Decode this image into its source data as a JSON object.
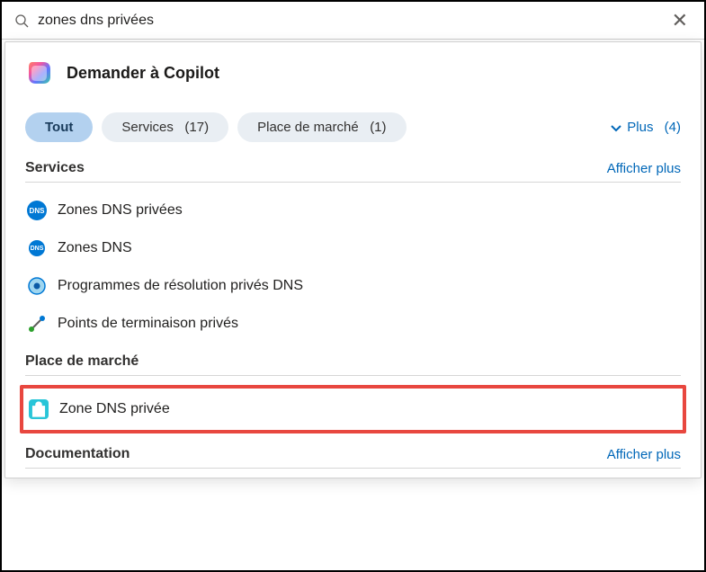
{
  "search": {
    "query": "zones dns privées",
    "placeholder": ""
  },
  "copilot": {
    "label": "Demander à Copilot"
  },
  "tabs": {
    "all": "Tout",
    "services_label": "Services",
    "services_count": "(17)",
    "marketplace_label": "Place de marché",
    "marketplace_count": "(1)",
    "more_label": "Plus",
    "more_count": "(4)"
  },
  "sections": {
    "services": {
      "title": "Services",
      "show_more": "Afficher plus",
      "items": [
        {
          "label": "Zones DNS privées"
        },
        {
          "label": "Zones DNS"
        },
        {
          "label": "Programmes de résolution privés DNS"
        },
        {
          "label": "Points de terminaison privés"
        }
      ]
    },
    "marketplace": {
      "title": "Place de marché",
      "items": [
        {
          "label": "Zone DNS privée"
        }
      ]
    },
    "documentation": {
      "title": "Documentation",
      "show_more": "Afficher plus"
    }
  }
}
